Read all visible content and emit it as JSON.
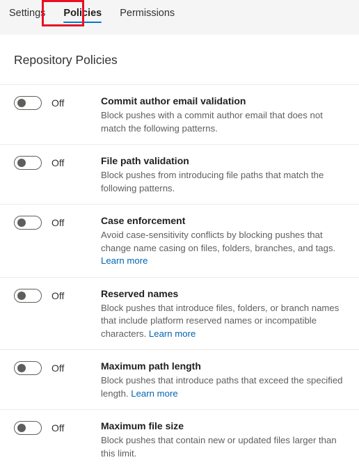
{
  "tabs": [
    {
      "label": "Settings",
      "selected": false
    },
    {
      "label": "Policies",
      "selected": true
    },
    {
      "label": "Permissions",
      "selected": false
    }
  ],
  "heading": "Repository Policies",
  "colors": {
    "accent": "#0078d4",
    "annotation": "#e81123",
    "link": "#0065b3",
    "tabbar_background": "#f5f5f5",
    "divider": "#edebe9"
  },
  "policies": [
    {
      "toggle_state": "Off",
      "title": "Commit author email validation",
      "description": "Block pushes with a commit author email that does not match the following patterns.",
      "link": null
    },
    {
      "toggle_state": "Off",
      "title": "File path validation",
      "description": "Block pushes from introducing file paths that match the following patterns.",
      "link": null
    },
    {
      "toggle_state": "Off",
      "title": "Case enforcement",
      "description": "Avoid case-sensitivity conflicts by blocking pushes that change name casing on files, folders, branches, and tags. ",
      "link": "Learn more"
    },
    {
      "toggle_state": "Off",
      "title": "Reserved names",
      "description": "Block pushes that introduce files, folders, or branch names that include platform reserved names or incompatible characters. ",
      "link": "Learn more"
    },
    {
      "toggle_state": "Off",
      "title": "Maximum path length",
      "description": "Block pushes that introduce paths that exceed the specified length. ",
      "link": "Learn more"
    },
    {
      "toggle_state": "Off",
      "title": "Maximum file size",
      "description": "Block pushes that contain new or updated files larger than this limit.",
      "link": null
    }
  ]
}
